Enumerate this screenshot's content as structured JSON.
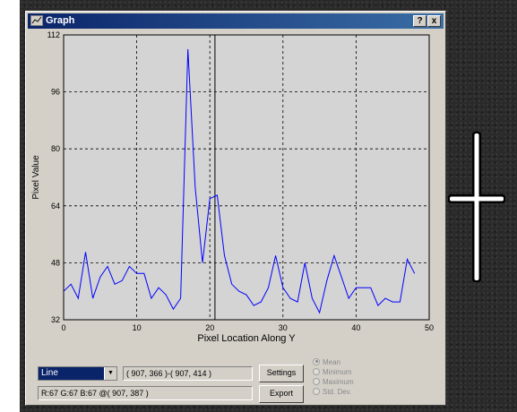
{
  "window": {
    "title": "Graph",
    "help_label": "?",
    "close_label": "x"
  },
  "chart_data": {
    "type": "line",
    "title": "",
    "xlabel": "Pixel Location Along Y",
    "ylabel": "Pixel Value",
    "xlim": [
      0,
      50
    ],
    "ylim": [
      32,
      112
    ],
    "x_ticks": [
      0,
      10,
      20,
      30,
      40,
      50
    ],
    "y_ticks": [
      32,
      48,
      64,
      80,
      96,
      112
    ],
    "grid": true,
    "cursor_x": 20.7,
    "colors": {
      "line": "#0000ff",
      "plot_bg": "#d4d4d4",
      "cursor": "#000000"
    },
    "series": [
      {
        "x": [
          0,
          1,
          2,
          3,
          4,
          5,
          6,
          7,
          8,
          9,
          10,
          11,
          12,
          13,
          14,
          15,
          16,
          17,
          18,
          19,
          20,
          21,
          22,
          23,
          24,
          25,
          26,
          27,
          28,
          29,
          30,
          31,
          32,
          33,
          34,
          35,
          36,
          37,
          38,
          39,
          40,
          41,
          42,
          43,
          44,
          45,
          46,
          47,
          48
        ],
        "values": [
          40,
          42,
          38,
          51,
          38,
          44,
          47,
          42,
          43,
          47,
          45,
          45,
          38,
          41,
          39,
          35,
          38,
          108,
          69,
          48,
          66,
          67,
          50,
          42,
          40,
          39,
          36,
          37,
          41,
          50,
          41,
          38,
          37,
          48,
          38,
          34,
          43,
          50,
          44,
          38,
          41,
          41,
          41,
          36,
          38,
          37,
          37,
          49,
          45
        ]
      }
    ]
  },
  "controls": {
    "mode_value": "Line",
    "coords_text": "( 907, 366 )-( 907, 414 )",
    "pixel_text": "R:67 G:67 B:67 @( 907, 387 )",
    "settings_label": "Settings",
    "export_label": "Export",
    "radio_options": [
      "Mean",
      "Minimum",
      "Maximum",
      "Std. Dev."
    ],
    "radio_selected": 0
  }
}
